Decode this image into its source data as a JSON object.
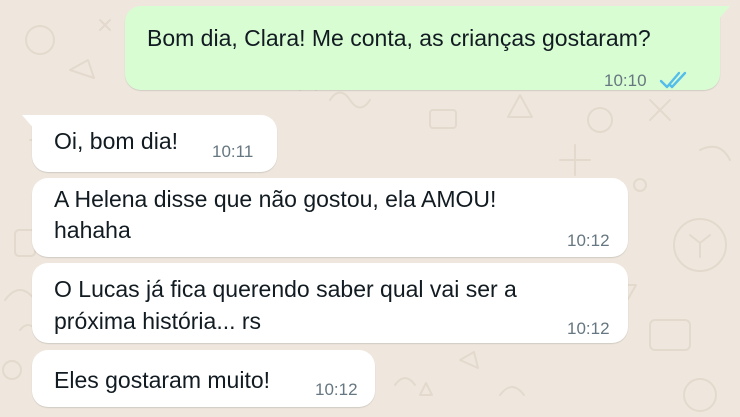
{
  "colors": {
    "background": "#efe7dd",
    "outgoing_bubble": "#d9fdd3",
    "incoming_bubble": "#ffffff",
    "timestamp": "#667781",
    "read_ticks": "#53bdeb"
  },
  "messages": [
    {
      "direction": "outgoing",
      "lines": [
        "Bom dia, Clara! Me conta, as crianças gostaram?"
      ],
      "time": "10:10",
      "status_icon": "double-check-read-icon"
    },
    {
      "direction": "incoming",
      "lines": [
        "Oi, bom dia!"
      ],
      "time": "10:11"
    },
    {
      "direction": "incoming",
      "lines": [
        "A Helena disse que não gostou, ela AMOU!",
        "hahaha"
      ],
      "time": "10:12"
    },
    {
      "direction": "incoming",
      "lines": [
        "O Lucas já fica querendo saber qual vai ser a",
        "próxima história... rs"
      ],
      "time": "10:12"
    },
    {
      "direction": "incoming",
      "lines": [
        "Eles gostaram muito!"
      ],
      "time": "10:12"
    }
  ]
}
